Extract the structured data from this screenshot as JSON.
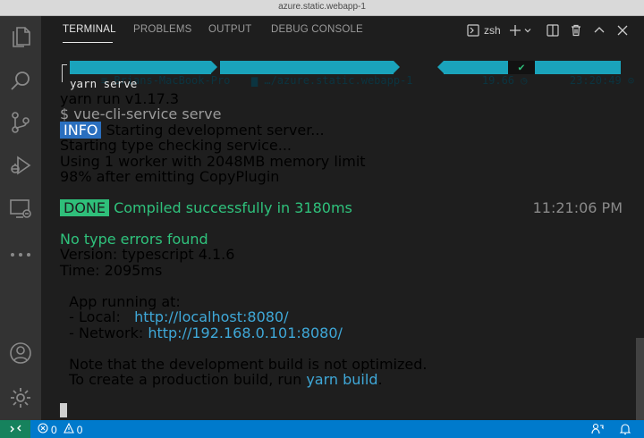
{
  "window": {
    "title": "azure.static.webapp-1"
  },
  "activity_bar": {
    "icons": [
      "explorer-icon",
      "search-icon",
      "source-control-icon",
      "run-debug-icon",
      "remote-explorer-icon",
      "more-icon",
      "accounts-icon",
      "settings-gear-icon"
    ]
  },
  "panel": {
    "tabs": [
      {
        "label": "TERMINAL",
        "active": true
      },
      {
        "label": "PROBLEMS",
        "active": false
      },
      {
        "label": "OUTPUT",
        "active": false
      },
      {
        "label": "DEBUG CONSOLE",
        "active": false
      }
    ],
    "shell_label": "zsh"
  },
  "prompt": {
    "host": "Brians-MacBook-Pro",
    "dir": "…/azure.static.webapp-1",
    "duration": "19.66",
    "status": "✔",
    "time": "23:20:49",
    "command": "yarn serve"
  },
  "terminal": {
    "l1": "yarn run v1.17.3",
    "l2": "$ vue-cli-service serve",
    "info_badge": "INFO",
    "l3": " Starting development server...",
    "l4": "Starting type checking service...",
    "l5": "Using 1 worker with 2048MB memory limit",
    "l6": "98% after emitting CopyPlugin",
    "done_badge": "DONE",
    "l7": " Compiled successfully in 3180ms",
    "l7_time": "11:21:06 PM",
    "l8": "No type errors found",
    "l9": "Version: typescript 4.1.6",
    "l10": "Time: 2095ms",
    "l11": "  App running at:",
    "local_label": "  - Local:   ",
    "local_url": "http://localhost:8080/",
    "network_label": "  - Network: ",
    "network_url": "http://192.168.0.101:8080/",
    "l13": "  Note that the development build is not optimized.",
    "l14_pre": "  To create a production build, run ",
    "l14_cmd": "yarn build",
    "l14_post": "."
  },
  "status_bar": {
    "errors": "0",
    "warnings": "0"
  },
  "colors": {
    "activity_bar": "#333333",
    "status_bar": "#007acc",
    "remote": "#16825d",
    "prompt_segment": "#1aa3bb",
    "success": "#2fc27c",
    "info": "#2a6fbf"
  }
}
